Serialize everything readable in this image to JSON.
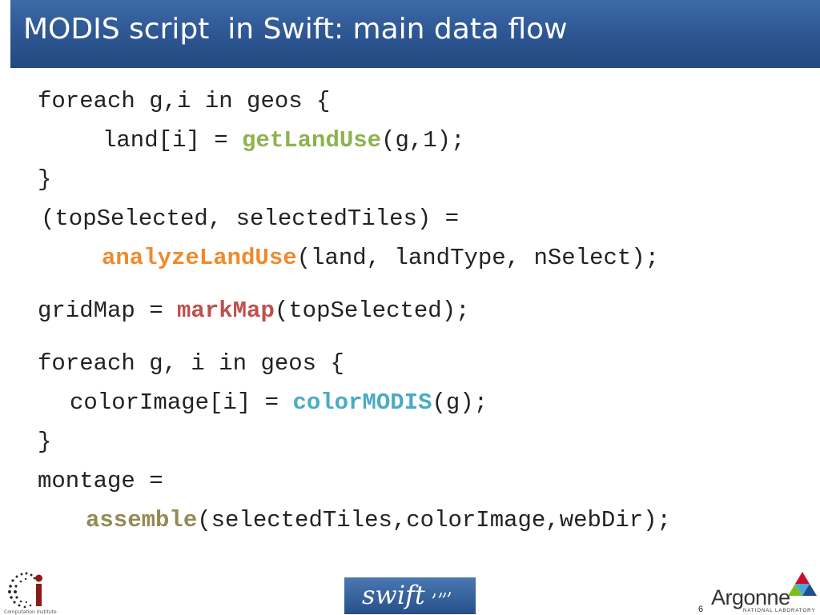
{
  "slide": {
    "title": "MODIS script  in Swift: main data flow",
    "page_number": "6"
  },
  "code": {
    "line1": "foreach g,i in geos {",
    "line2_pre": "land[i] = ",
    "line2_fn": "getLandUse",
    "line2_post": "(g,1);",
    "line3": "}",
    "line4": "(topSelected, selectedTiles) =",
    "line5_fn": "analyzeLandUse",
    "line5_post": "(land, landType, nSelect);",
    "line6_pre": "gridMap = ",
    "line6_fn": "markMap",
    "line6_post": "(topSelected);",
    "line7": "foreach g, i in geos {",
    "line8_pre": "colorImage[i] = ",
    "line8_fn": "colorMODIS",
    "line8_post": "(g);",
    "line9": "}",
    "line10": "montage =",
    "line11_fn": "assemble",
    "line11_post": "(selectedTiles,colorImage,webDir);"
  },
  "colors": {
    "title_bar": "#2c5591",
    "getLandUse": "#8db24f",
    "analyzeLandUse": "#f08a2c",
    "markMap": "#c0504d",
    "colorMODIS": "#4aabc5",
    "assemble": "#948a54"
  },
  "footer": {
    "ci_logo": {
      "icon": "ci-logo-icon",
      "caption": "Computation Institute"
    },
    "swift_logo": {
      "icon": "swift-logo-icon",
      "text": "swift"
    },
    "argonne_logo": {
      "icon": "argonne-triangle-icon",
      "name": "Argonne",
      "subtitle": "NATIONAL LABORATORY"
    }
  }
}
